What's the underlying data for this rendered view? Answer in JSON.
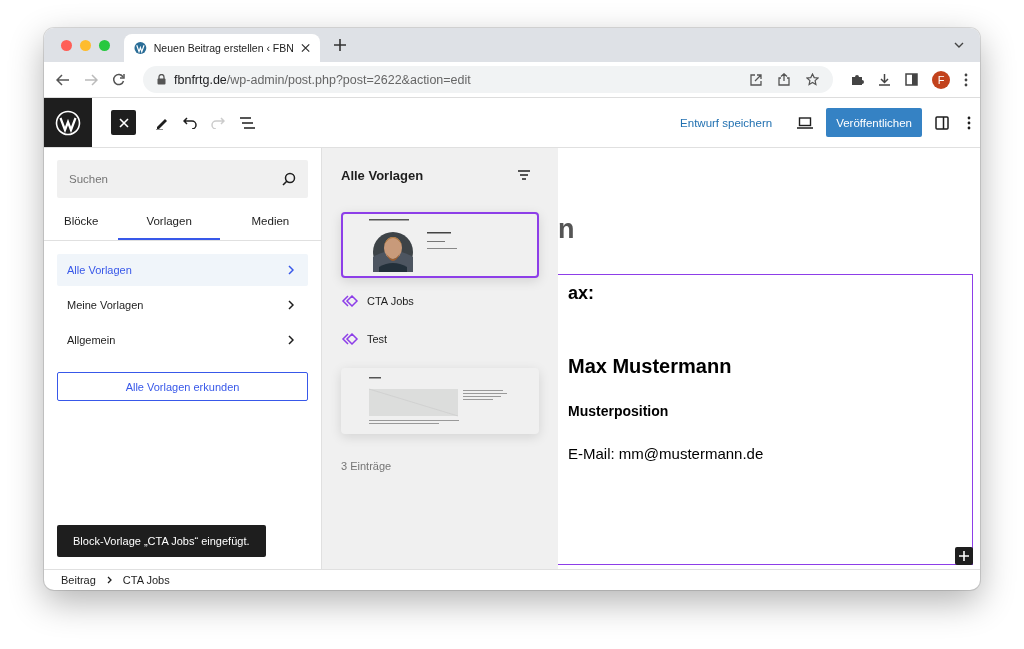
{
  "browser": {
    "tab_title": "Neuen Beitrag erstellen ‹ FBN",
    "url_domain": "fbnfrtg.de",
    "url_path": "/wp-admin/post.php?post=2622&action=edit",
    "profile_initial": "F"
  },
  "toolbar": {
    "save_draft": "Entwurf speichern",
    "publish": "Veröffentlichen"
  },
  "inserter": {
    "search_placeholder": "Suchen",
    "tabs": [
      {
        "label": "Blöcke",
        "selected": false
      },
      {
        "label": "Vorlagen",
        "selected": true
      },
      {
        "label": "Medien",
        "selected": false
      }
    ],
    "categories": [
      {
        "label": "Alle Vorlagen",
        "selected": true
      },
      {
        "label": "Meine Vorlagen",
        "selected": false
      },
      {
        "label": "Allgemein",
        "selected": false
      }
    ],
    "explore_button": "Alle Vorlagen erkunden",
    "snackbar": "Block-Vorlage „CTA Jobs“ eingefügt."
  },
  "patterns_panel": {
    "title": "Alle Vorlagen",
    "items": [
      {
        "kind": "portrait",
        "selected": true
      },
      {
        "kind": "named",
        "label": "CTA Jobs"
      },
      {
        "kind": "named",
        "label": "Test"
      },
      {
        "kind": "layout",
        "selected": false
      }
    ],
    "count": "3 Einträge"
  },
  "canvas": {
    "heading_fragment": "n",
    "block_heading_fragment": "ax:",
    "name": "Max Mustermann",
    "position": "Musterposition",
    "email": "E-Mail: mm@mustermann.de"
  },
  "breadcrumb": [
    "Beitrag",
    "CTA Jobs"
  ]
}
